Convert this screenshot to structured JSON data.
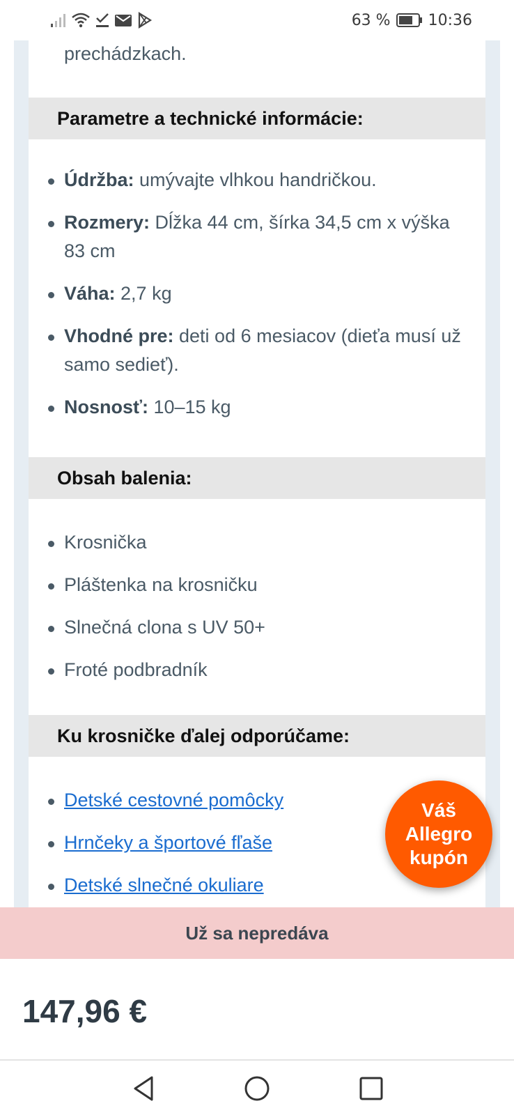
{
  "status_bar": {
    "battery_percent": "63 %",
    "time": "10:36",
    "icons": [
      "signal-icon",
      "wifi-icon",
      "check-download-icon",
      "mail-icon",
      "play-store-icon",
      "battery-icon"
    ]
  },
  "intro": {
    "text": "prechádzkach."
  },
  "sections": {
    "params": {
      "title": "Parametre a technické informácie:",
      "items": [
        {
          "label": "Údržba:",
          "value": " umývajte vlhkou handričkou."
        },
        {
          "label": "Rozmery:",
          "value": " Dĺžka 44 cm, šírka 34,5 cm x výška 83 cm"
        },
        {
          "label": "Váha:",
          "value": " 2,7 kg"
        },
        {
          "label": "Vhodné pre:",
          "value": " deti od 6 mesiacov (dieťa musí už samo sedieť)."
        },
        {
          "label": "Nosnosť:",
          "value": " 10–15 kg"
        }
      ]
    },
    "package": {
      "title": "Obsah balenia:",
      "items": [
        "Krosnička",
        "Pláštenka na krosničku",
        "Slnečná clona s UV 50+",
        "Froté podbradník"
      ]
    },
    "recommend": {
      "title": "Ku krosničke ďalej odporúčame:",
      "links": [
        "Detské cestovné pomôcky",
        "Hrnčeky a športové fľaše",
        "Detské slnečné okuliare"
      ]
    }
  },
  "coupon": {
    "line1": "Váš",
    "line2": "Allegro",
    "line3": "kupón",
    "color": "#ff5a00"
  },
  "sold_banner": {
    "text": "Už sa nepredáva",
    "color": "#f4cccc"
  },
  "price": {
    "value": "147,96 €"
  },
  "nav": {
    "buttons": [
      "back-icon",
      "home-icon",
      "recents-icon"
    ]
  }
}
